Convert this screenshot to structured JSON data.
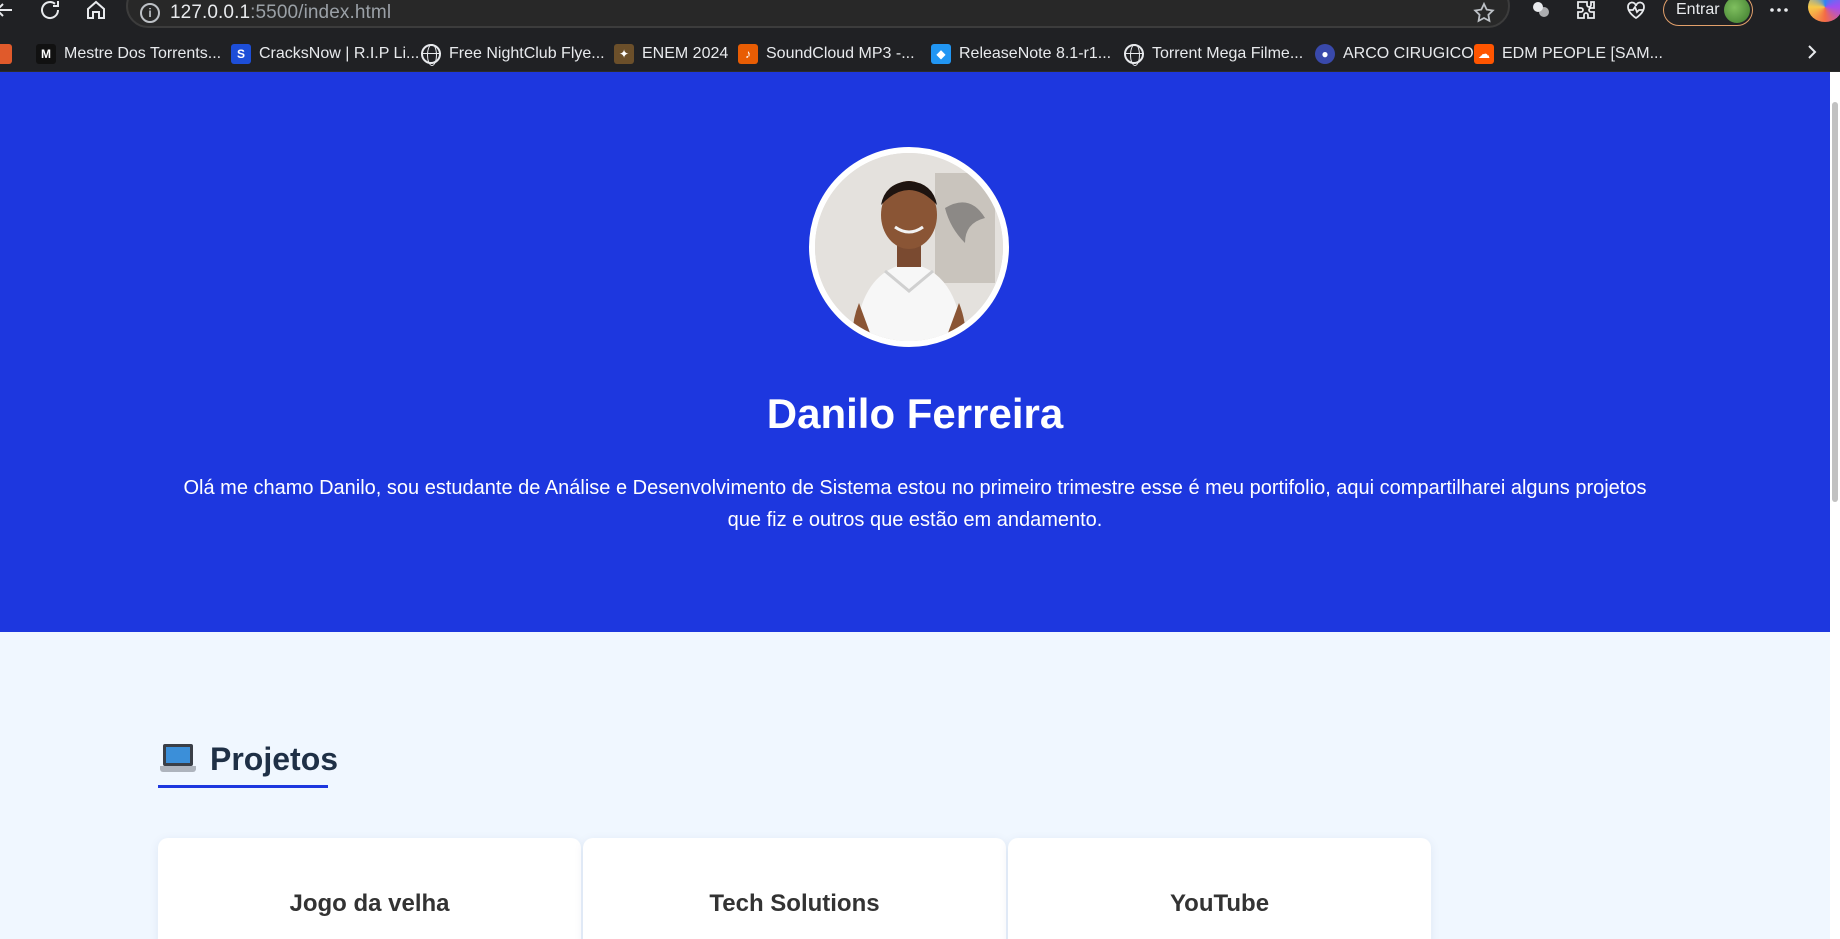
{
  "browser": {
    "url_host": "127.0.0.1",
    "url_rest": ":5500/index.html",
    "signin_label": "Entrar",
    "bookmarks": [
      {
        "label": "Mestre Dos Torrents...",
        "fav": "M",
        "color": "#111111"
      },
      {
        "label": "CracksNow | R.I.P Li...",
        "fav": "S",
        "color": "#1d4ed8"
      },
      {
        "label": "Free NightClub Flye...",
        "fav": "globe",
        "color": ""
      },
      {
        "label": "ENEM 2024",
        "fav": "✦",
        "color": "#6b4f2a"
      },
      {
        "label": "SoundCloud MP3 -...",
        "fav": "♪",
        "color": "#e85d04"
      },
      {
        "label": "ReleaseNote 8.1-r1...",
        "fav": "◆",
        "color": "#2196f3"
      },
      {
        "label": "Torrent Mega Filme...",
        "fav": "globe",
        "color": ""
      },
      {
        "label": "ARCO CIRUGICO",
        "fav": "●",
        "color": "#3949ab"
      },
      {
        "label": "EDM PEOPLE [SAM...",
        "fav": "☁",
        "color": "#ff5500"
      }
    ]
  },
  "colors": {
    "hero_bg": "#1d37df",
    "page_bg": "#f0f7ff",
    "accent": "#1d37df",
    "title_text": "#1f3046"
  },
  "hero": {
    "name": "Danilo Ferreira",
    "bio": "Olá me chamo Danilo, sou estudante de Análise e Desenvolvimento de Sistema estou no primeiro trimestre esse é meu portifolio, aqui compartilharei alguns projetos que fiz e outros que estão em andamento."
  },
  "projects": {
    "icon": "laptop-icon",
    "title": "Projetos",
    "cards": [
      {
        "title": "Jogo da velha"
      },
      {
        "title": "Tech Solutions"
      },
      {
        "title": "YouTube"
      }
    ]
  }
}
